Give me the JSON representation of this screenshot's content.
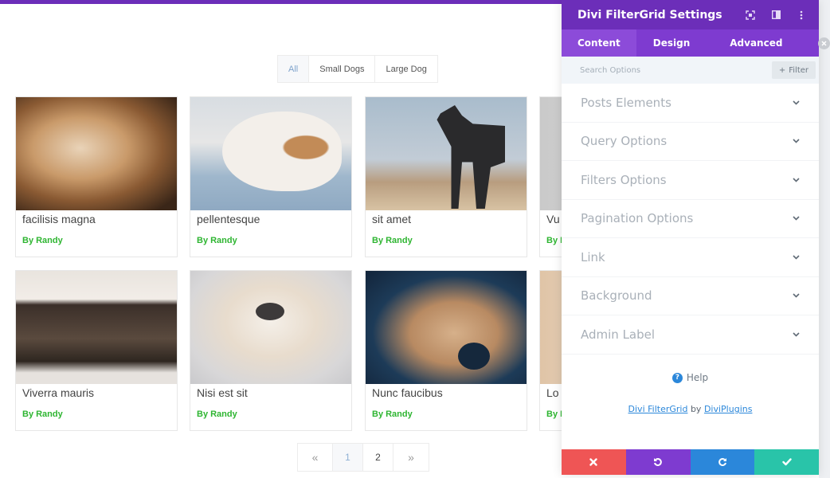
{
  "page": {
    "filters": [
      {
        "label": "All",
        "active": true
      },
      {
        "label": "Small Dogs",
        "active": false
      },
      {
        "label": "Large Dog",
        "active": false
      }
    ],
    "posts": [
      {
        "title": "facilisis magna",
        "author": "By Randy"
      },
      {
        "title": "pellentesque",
        "author": "By Randy"
      },
      {
        "title": "sit amet",
        "author": "By Randy"
      },
      {
        "title": "Vu",
        "author": "By R"
      },
      {
        "title": "Viverra mauris",
        "author": "By Randy"
      },
      {
        "title": "Nisi est sit",
        "author": "By Randy"
      },
      {
        "title": "Nunc faucibus",
        "author": "By Randy"
      },
      {
        "title": "Lo",
        "author": "By R"
      }
    ],
    "pagination": {
      "prev": "«",
      "pages": [
        "1",
        "2"
      ],
      "current": "1",
      "next": "»"
    }
  },
  "panel": {
    "title": "Divi FilterGrid Settings",
    "header_icons": [
      "expand-icon",
      "split-view-icon",
      "more-options-icon"
    ],
    "tabs": [
      {
        "label": "Content",
        "active": true
      },
      {
        "label": "Design",
        "active": false
      },
      {
        "label": "Advanced",
        "active": false
      }
    ],
    "search_placeholder": "Search Options",
    "filter_label": "Filter",
    "sections": [
      "Posts Elements",
      "Query Options",
      "Filters Options",
      "Pagination Options",
      "Link",
      "Background",
      "Admin Label"
    ],
    "help_label": "Help",
    "credits": {
      "plugin": "Divi FilterGrid",
      "by": "by",
      "author": "DiviPlugins"
    },
    "actions": [
      "cancel",
      "undo",
      "redo",
      "save"
    ]
  },
  "colors": {
    "brand_purple": "#6c2eb9",
    "tab_purple": "#7e3bd0",
    "author_green": "#2eb531",
    "cancel_red": "#ef5555",
    "redo_blue": "#2b87da",
    "save_teal": "#29c4a9"
  }
}
